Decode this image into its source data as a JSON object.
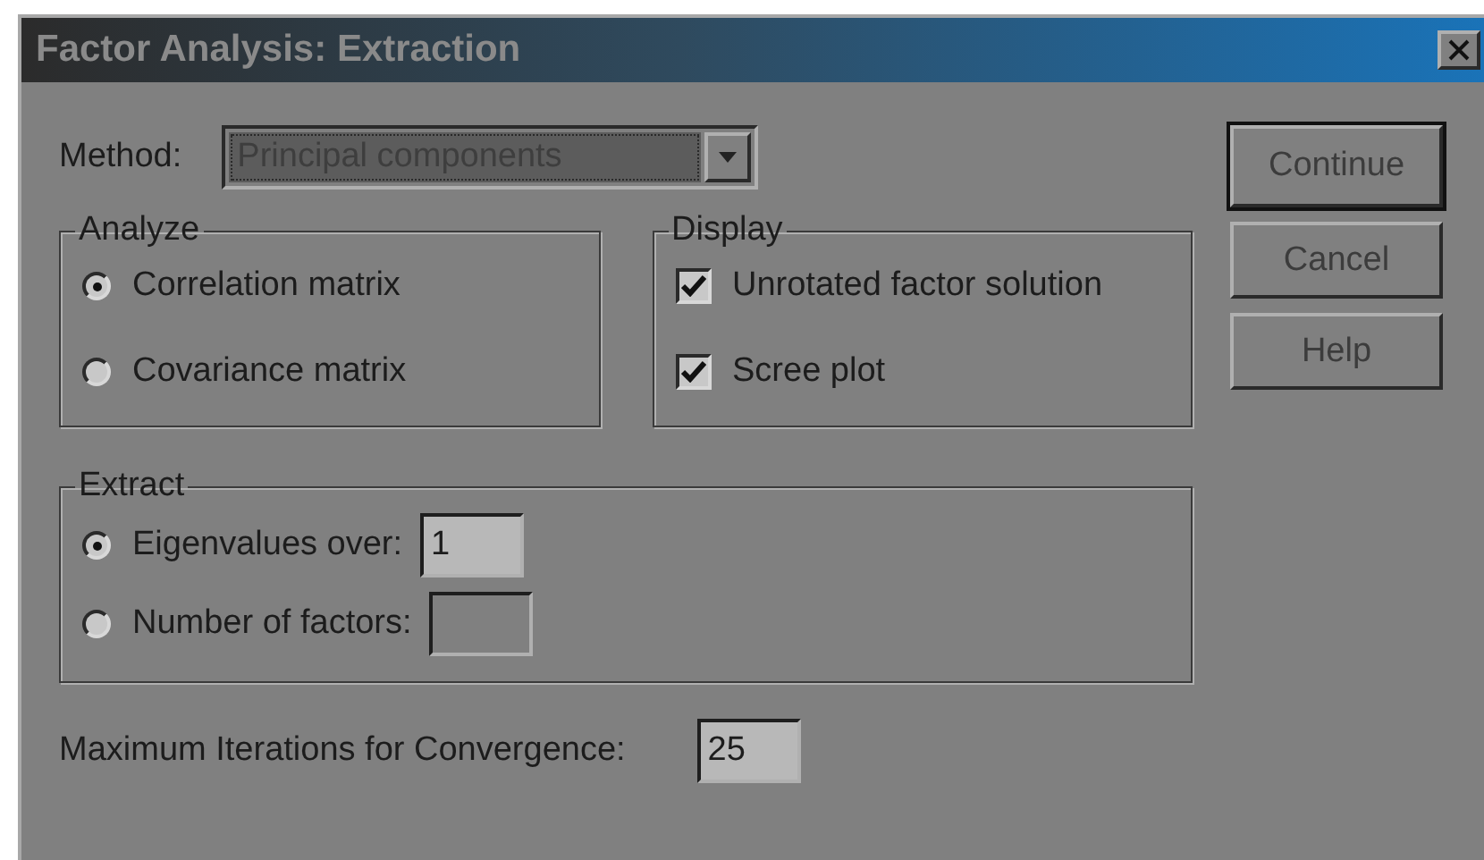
{
  "window": {
    "title": "Factor Analysis: Extraction"
  },
  "method": {
    "label": "Method:",
    "value": "Principal components"
  },
  "analyze": {
    "title": "Analyze",
    "options": [
      {
        "label": "Correlation matrix",
        "selected": true
      },
      {
        "label": "Covariance matrix",
        "selected": false
      }
    ]
  },
  "display": {
    "title": "Display",
    "options": [
      {
        "label": "Unrotated factor solution",
        "checked": true
      },
      {
        "label": "Scree plot",
        "checked": true
      }
    ]
  },
  "extract": {
    "title": "Extract",
    "options": [
      {
        "label": "Eigenvalues over:",
        "selected": true,
        "value": "1"
      },
      {
        "label": "Number of factors:",
        "selected": false
      }
    ]
  },
  "iterations": {
    "label": "Maximum Iterations for Convergence:",
    "value": "25"
  },
  "buttons": [
    {
      "label": "Continue",
      "default": true
    },
    {
      "label": "Cancel",
      "default": false
    },
    {
      "label": "Help",
      "default": false
    }
  ]
}
